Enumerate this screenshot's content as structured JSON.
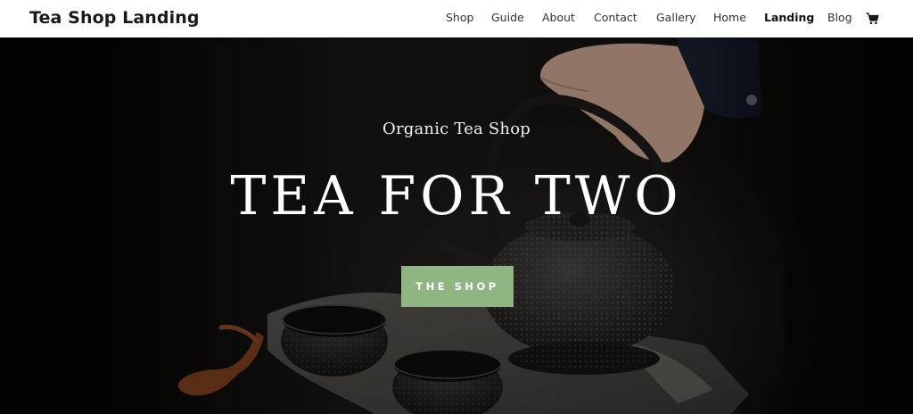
{
  "site": {
    "title": "Tea Shop Landing"
  },
  "nav": {
    "items": [
      {
        "label": "Shop",
        "active": false
      },
      {
        "label": "Guide",
        "active": false
      },
      {
        "label": "About",
        "active": false
      },
      {
        "label": "Contact",
        "active": false
      },
      {
        "label": "Gallery",
        "active": false
      },
      {
        "label": "Home",
        "active": false
      },
      {
        "label": "Landing",
        "active": true
      },
      {
        "label": "Blog",
        "active": false
      }
    ],
    "cart_icon": "shopping-cart-icon"
  },
  "hero": {
    "subtitle": "Organic Tea Shop",
    "title": "TEA FOR TWO",
    "button_label": "THE SHOP",
    "image": "cast-iron-teapot-with-tea-cups-photo"
  },
  "colors": {
    "accent": "#8fb583",
    "header_bg": "#ffffff",
    "hero_bg": "#0e0c0b",
    "text_dark": "#1a1a1a"
  }
}
